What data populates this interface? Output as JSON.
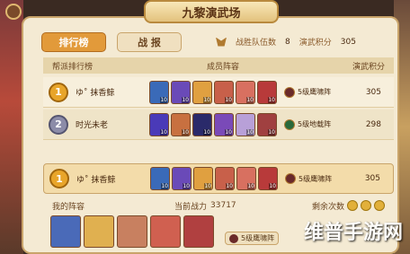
{
  "title": "九黎演武场",
  "tabs": {
    "ranking": "排行榜",
    "battle_report": "战 报"
  },
  "stats": {
    "wins_label": "战胜队伍数",
    "wins_value": "8",
    "score_label": "演武积分",
    "score_value": "305"
  },
  "table": {
    "col_rank": "帮派排行榜",
    "col_lineup": "成员阵容",
    "col_score": "演武积分"
  },
  "rows": [
    {
      "rank": "1",
      "name": "ゆ˚ 抹香鲸",
      "formation": "5级鹰啸阵",
      "score": "305",
      "ficon_color": "red"
    },
    {
      "rank": "2",
      "name": "时光未老",
      "formation": "5级地载阵",
      "score": "298",
      "ficon_color": "green"
    }
  ],
  "me_row": {
    "rank": "1",
    "name": "ゆ˚ 抹香鲸",
    "formation": "5级鹰啸阵",
    "score": "305"
  },
  "my_lineup": {
    "label": "我的阵容",
    "power_label": "当前战力",
    "power_value": "33717",
    "remain_label": "剩余次数"
  },
  "bottom_formation": "5级鹰啸阵",
  "hero_levels": [
    "10",
    "10",
    "10",
    "10",
    "10",
    "10",
    "10"
  ],
  "watermark": "维普手游网",
  "colors": {
    "gold": "#e8a52a",
    "silver": "#8c8ca8",
    "active_tab": "#e29a3a"
  }
}
